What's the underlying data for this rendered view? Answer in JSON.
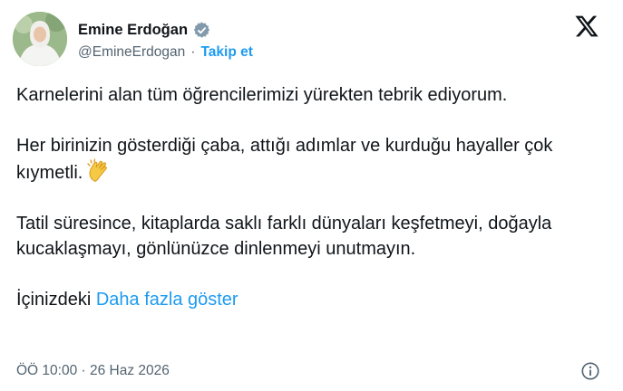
{
  "tweet": {
    "author_name": "Emine Erdoğan",
    "handle": "@EmineErdogan",
    "separator": "·",
    "follow_label": "Takip et",
    "paragraphs": [
      "Karnelerini alan tüm öğrencilerimizi yürekten tebrik ediyorum.",
      "Her birinizin gösterdiği çaba, attığı adımlar ve kurduğu hayaller çok kıymetli.",
      "Tatil süresince, kitaplarda saklı farklı dünyaları keşfetmeyi, doğayla kucaklaşmayı, gönlünüzce dinlenmeyi unutmayın."
    ],
    "truncated_text": "İçinizdeki",
    "show_more_label": "Daha fazla göster",
    "timestamp": "ÖÖ 10:00 · 26 Haz 2026",
    "icons": [
      "avatar",
      "verified-badge-icon",
      "x-logo-icon",
      "clapping-hands-emoji-icon",
      "info-icon"
    ],
    "colors": {
      "accent": "#1d9bf0",
      "text": "#0f1419",
      "muted": "#536471"
    }
  }
}
